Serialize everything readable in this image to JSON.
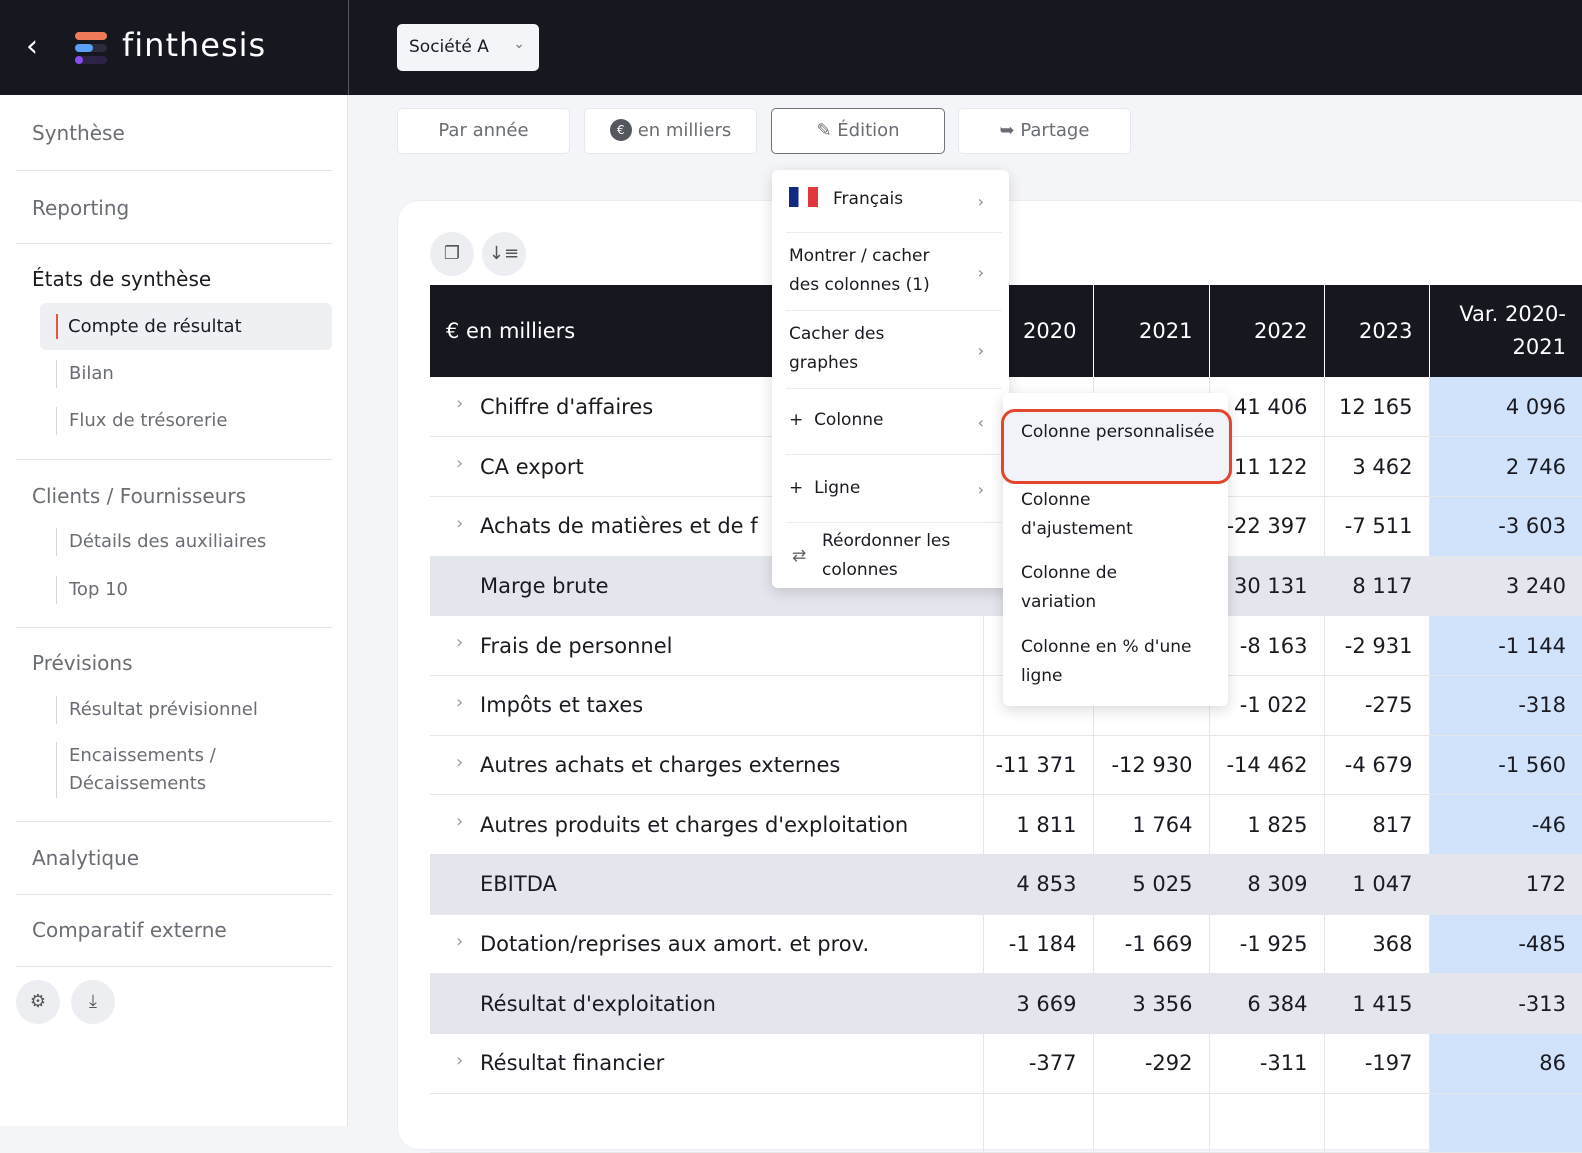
{
  "app": {
    "brand": "finthesis",
    "company": "Société A"
  },
  "sidebar": {
    "sections": [
      {
        "title": "Synthèse"
      },
      {
        "title": "Reporting"
      },
      {
        "title": "États de synthèse",
        "items": [
          "Compte de résultat",
          "Bilan",
          "Flux de trésorerie"
        ]
      },
      {
        "title": "Clients / Fournisseurs",
        "items": [
          "Détails des auxiliaires",
          "Top 10"
        ]
      },
      {
        "title": "Prévisions",
        "items": [
          "Résultat prévisionnel",
          "Encaissements / Décaissements"
        ]
      },
      {
        "title": "Analytique"
      },
      {
        "title": "Comparatif externe"
      }
    ],
    "active_item": "Compte de résultat"
  },
  "toolbar": {
    "period": "Par année",
    "unit": "en milliers",
    "edition": "Édition",
    "share": "Partage"
  },
  "table": {
    "headers": [
      "€ en milliers",
      "2020",
      "2021",
      "2022",
      "2023",
      "Var. 2020-2021"
    ],
    "rows": [
      {
        "label": "Chiffre d'affaires",
        "values": [
          "",
          "",
          "41 406",
          "12 165",
          "4 096"
        ],
        "total": false
      },
      {
        "label": "CA export",
        "values": [
          "",
          "",
          "11 122",
          "3 462",
          "2 746"
        ],
        "total": false
      },
      {
        "label": "Achats de matières et de f",
        "values": [
          "",
          "",
          "-22 397",
          "-7 511",
          "-3 603"
        ],
        "total": false
      },
      {
        "label": "Marge brute",
        "values": [
          "",
          "",
          "30 131",
          "8 117",
          "3 240"
        ],
        "total": true
      },
      {
        "label": "Frais de personnel",
        "values": [
          "",
          "",
          "-8 163",
          "-2 931",
          "-1 144"
        ],
        "total": false
      },
      {
        "label": "Impôts et taxes",
        "values": [
          "",
          "",
          "-1 022",
          "-275",
          "-318"
        ],
        "total": false
      },
      {
        "label": "Autres achats et charges externes",
        "values": [
          "-11 371",
          "-12 930",
          "-14 462",
          "-4 679",
          "-1 560"
        ],
        "total": false
      },
      {
        "label": "Autres produits et charges d'exploitation",
        "values": [
          "1 811",
          "1 764",
          "1 825",
          "817",
          "-46"
        ],
        "total": false
      },
      {
        "label": "EBITDA",
        "values": [
          "4 853",
          "5 025",
          "8 309",
          "1 047",
          "172"
        ],
        "total": true
      },
      {
        "label": "Dotation/reprises aux amort. et prov.",
        "values": [
          "-1 184",
          "-1 669",
          "-1 925",
          "368",
          "-485"
        ],
        "total": false
      },
      {
        "label": "Résultat d'exploitation",
        "values": [
          "3 669",
          "3 356",
          "6 384",
          "1 415",
          "-313"
        ],
        "total": true
      },
      {
        "label": "Résultat financier",
        "values": [
          "-377",
          "-292",
          "-311",
          "-197",
          "86"
        ],
        "total": false
      },
      {
        "label": "",
        "values": [
          "",
          "",
          "",
          "",
          ""
        ],
        "total": false
      }
    ]
  },
  "menu": {
    "language": "Français",
    "show_hide": "Montrer / cacher des colonnes (1)",
    "hide_graphs": "Cacher des graphes",
    "add_column": "Colonne",
    "add_row": "Ligne",
    "reorder": "Réordonner les colonnes"
  },
  "submenu": {
    "items": [
      "Colonne personnalisée",
      "Colonne d'ajustement",
      "Colonne de variation",
      "Colonne en % d'une ligne"
    ],
    "highlighted": "Colonne personnalisée"
  },
  "colors": {
    "dark": "#16171f",
    "accent": "#e8553f",
    "highlight": "#e2462f",
    "var_column": "#d0e3fa"
  }
}
